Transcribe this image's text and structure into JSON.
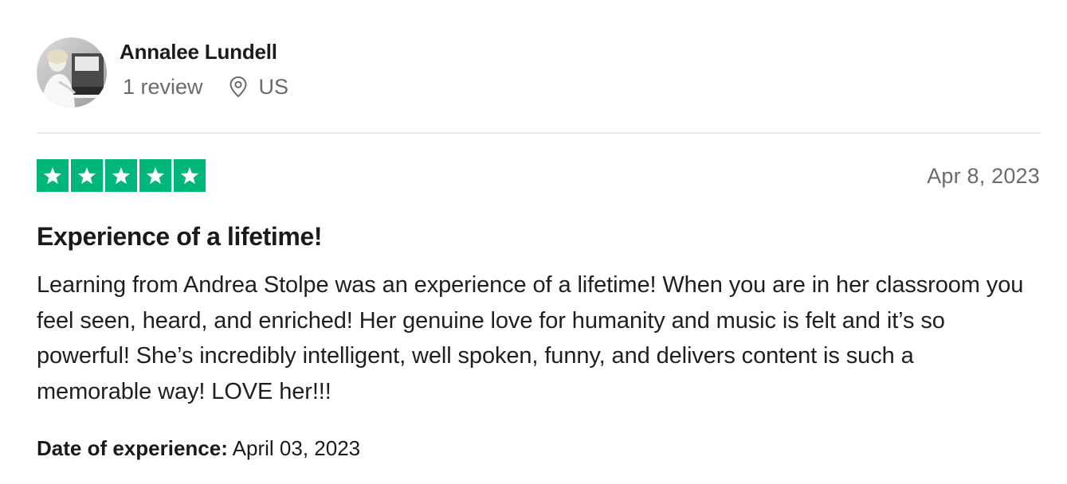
{
  "reviewer": {
    "name": "Annalee Lundell",
    "review_count": "1 review",
    "country": "US",
    "avatar_icon": "reviewer-photo"
  },
  "review": {
    "rating": 5,
    "rating_max": 5,
    "star_color": "#00b67a",
    "date": "Apr 8, 2023",
    "title": "Experience of a lifetime!",
    "body": "Learning from Andrea Stolpe was an experience of a lifetime! When you are in her classroom you feel seen, heard, and enriched! Her genuine love for humanity and music is felt and it’s so powerful! She’s incredibly intelligent, well spoken, funny, and delivers content is such a memorable way! LOVE her!!!",
    "experience_label": "Date of experience:",
    "experience_date": "April 03, 2023"
  }
}
